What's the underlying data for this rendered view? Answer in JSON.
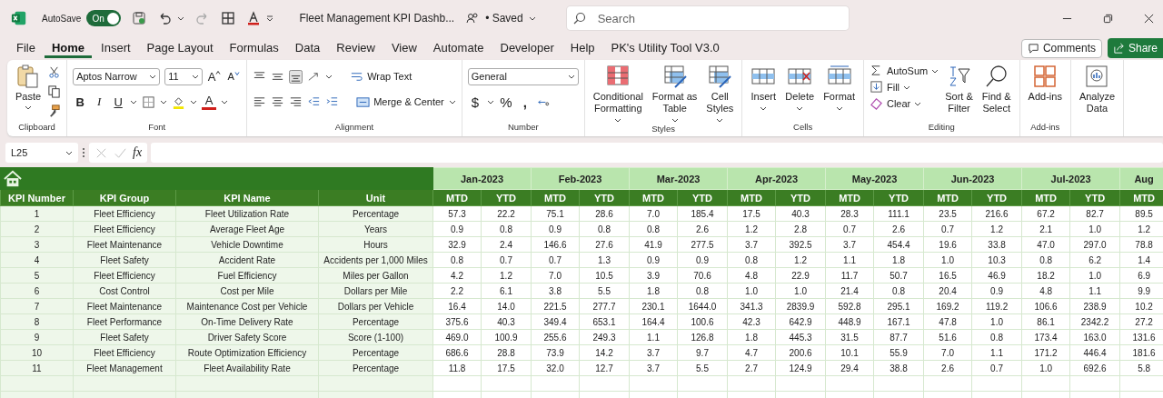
{
  "title_bar": {
    "autosave_label": "AutoSave",
    "autosave": {
      "on": true,
      "label": "On"
    },
    "document_title": "Fleet Management KPI Dashb...",
    "save_status": "• Saved",
    "search": {
      "placeholder": "Search"
    }
  },
  "tabs": [
    {
      "label": "File",
      "selected": false
    },
    {
      "label": "Home",
      "selected": true
    },
    {
      "label": "Insert",
      "selected": false
    },
    {
      "label": "Page Layout",
      "selected": false
    },
    {
      "label": "Formulas",
      "selected": false
    },
    {
      "label": "Data",
      "selected": false
    },
    {
      "label": "Review",
      "selected": false
    },
    {
      "label": "View",
      "selected": false
    },
    {
      "label": "Automate",
      "selected": false
    },
    {
      "label": "Developer",
      "selected": false
    },
    {
      "label": "Help",
      "selected": false
    },
    {
      "label": "PK's Utility Tool V3.0",
      "selected": false
    }
  ],
  "comments_button": "Comments",
  "share_button": "Share",
  "ribbon": [
    {
      "kind": "clipboard",
      "label": "Clipboard",
      "paste": "Paste"
    },
    {
      "kind": "font",
      "label": "Font",
      "font_name": "Aptos Narrow",
      "font_size": "11",
      "grow": "A",
      "shrink": "A",
      "bold": "B",
      "italic": "I",
      "underline": "U",
      "font_color": "A"
    },
    {
      "kind": "alignment",
      "label": "Alignment",
      "wrap": "Wrap Text",
      "merge": "Merge & Center"
    },
    {
      "kind": "number",
      "label": "Number",
      "format": "General",
      "currency": "$",
      "percent": "%",
      "comma": ","
    },
    {
      "kind": "styles",
      "label": "Styles",
      "buttons": [
        {
          "lines": [
            "Conditional",
            "Formatting"
          ]
        },
        {
          "lines": [
            "Format as",
            "Table"
          ]
        },
        {
          "lines": [
            "Cell",
            "Styles"
          ]
        }
      ]
    },
    {
      "kind": "cells",
      "label": "Cells",
      "buttons": [
        {
          "lines": [
            "Insert"
          ]
        },
        {
          "lines": [
            "Delete"
          ]
        },
        {
          "lines": [
            "Format"
          ]
        }
      ]
    },
    {
      "kind": "editing",
      "label": "Editing",
      "autosum": "AutoSum",
      "fill": "Fill",
      "clear": "Clear",
      "sort": [
        "Sort &",
        "Filter"
      ],
      "find": [
        "Find &",
        "Select"
      ]
    },
    {
      "kind": "addins",
      "label": "Add-ins",
      "buttons": [
        {
          "lines": [
            "Add-ins"
          ]
        }
      ]
    },
    {
      "kind": "analyze",
      "buttons": [
        {
          "lines": [
            "Analyze",
            "Data"
          ]
        }
      ]
    }
  ],
  "formula_bar": {
    "name_box": "L25",
    "fx": "fx"
  },
  "sheet": {
    "columns": [
      "KPI Number",
      "KPI Group",
      "KPI Name",
      "Unit"
    ],
    "months": [
      "Jan-2023",
      "Feb-2023",
      "Mar-2023",
      "Apr-2023",
      "May-2023",
      "Jun-2023",
      "Jul-2023",
      "Aug"
    ],
    "sub_columns": [
      "MTD",
      "YTD",
      "MTD",
      "YTD",
      "MTD",
      "YTD",
      "MTD",
      "YTD",
      "MTD",
      "YTD",
      "MTD",
      "YTD",
      "MTD",
      "YTD",
      "MTD"
    ],
    "rows": [
      {
        "number": "1",
        "group": "Fleet Efficiency",
        "name": "Fleet Utilization Rate",
        "unit": "Percentage",
        "values": [
          "57.3",
          "22.2",
          "75.1",
          "28.6",
          "7.0",
          "185.4",
          "17.5",
          "40.3",
          "28.3",
          "111.1",
          "23.5",
          "216.6",
          "67.2",
          "82.7",
          "89.5"
        ]
      },
      {
        "number": "2",
        "group": "Fleet Efficiency",
        "name": "Average Fleet Age",
        "unit": "Years",
        "values": [
          "0.9",
          "0.8",
          "0.9",
          "0.8",
          "0.8",
          "2.6",
          "1.2",
          "2.8",
          "0.7",
          "2.6",
          "0.7",
          "1.2",
          "2.1",
          "1.0",
          "1.2"
        ]
      },
      {
        "number": "3",
        "group": "Fleet Maintenance",
        "name": "Vehicle Downtime",
        "unit": "Hours",
        "values": [
          "32.9",
          "2.4",
          "146.6",
          "27.6",
          "41.9",
          "277.5",
          "3.7",
          "392.5",
          "3.7",
          "454.4",
          "19.6",
          "33.8",
          "47.0",
          "297.0",
          "78.8"
        ]
      },
      {
        "number": "4",
        "group": "Fleet Safety",
        "name": "Accident Rate",
        "unit": "Accidents per 1,000 Miles",
        "values": [
          "0.8",
          "0.7",
          "0.7",
          "1.3",
          "0.9",
          "0.9",
          "0.8",
          "1.2",
          "1.1",
          "1.8",
          "1.0",
          "10.3",
          "0.8",
          "6.2",
          "1.4"
        ]
      },
      {
        "number": "5",
        "group": "Fleet Efficiency",
        "name": "Fuel Efficiency",
        "unit": "Miles per Gallon",
        "values": [
          "4.2",
          "1.2",
          "7.0",
          "10.5",
          "3.9",
          "70.6",
          "4.8",
          "22.9",
          "11.7",
          "50.7",
          "16.5",
          "46.9",
          "18.2",
          "1.0",
          "6.9"
        ]
      },
      {
        "number": "6",
        "group": "Cost Control",
        "name": "Cost per Mile",
        "unit": "Dollars per Mile",
        "values": [
          "2.2",
          "6.1",
          "3.8",
          "5.5",
          "1.8",
          "0.8",
          "1.0",
          "1.0",
          "21.4",
          "0.8",
          "20.4",
          "0.9",
          "4.8",
          "1.1",
          "9.9"
        ]
      },
      {
        "number": "7",
        "group": "Fleet Maintenance",
        "name": "Maintenance Cost per Vehicle",
        "unit": "Dollars per Vehicle",
        "values": [
          "16.4",
          "14.0",
          "221.5",
          "277.7",
          "230.1",
          "1644.0",
          "341.3",
          "2839.9",
          "592.8",
          "295.1",
          "169.2",
          "119.2",
          "106.6",
          "238.9",
          "10.2"
        ]
      },
      {
        "number": "8",
        "group": "Fleet Performance",
        "name": "On-Time Delivery Rate",
        "unit": "Percentage",
        "values": [
          "375.6",
          "40.3",
          "349.4",
          "653.1",
          "164.4",
          "100.6",
          "42.3",
          "642.9",
          "448.9",
          "167.1",
          "47.8",
          "1.0",
          "86.1",
          "2342.2",
          "27.2"
        ]
      },
      {
        "number": "9",
        "group": "Fleet Safety",
        "name": "Driver Safety Score",
        "unit": "Score (1-100)",
        "values": [
          "469.0",
          "100.9",
          "255.6",
          "249.3",
          "1.1",
          "126.8",
          "1.8",
          "445.3",
          "31.5",
          "87.7",
          "51.6",
          "0.8",
          "173.4",
          "163.0",
          "131.6"
        ]
      },
      {
        "number": "10",
        "group": "Fleet Efficiency",
        "name": "Route Optimization Efficiency",
        "unit": "Percentage",
        "values": [
          "686.6",
          "28.8",
          "73.9",
          "14.2",
          "3.7",
          "9.7",
          "4.7",
          "200.6",
          "10.1",
          "55.9",
          "7.0",
          "1.1",
          "171.2",
          "446.4",
          "181.6"
        ]
      },
      {
        "number": "11",
        "group": "Fleet Management",
        "name": "Fleet Availability Rate",
        "unit": "Percentage",
        "values": [
          "11.8",
          "17.5",
          "32.0",
          "12.7",
          "3.7",
          "5.5",
          "2.7",
          "124.9",
          "29.4",
          "38.8",
          "2.6",
          "0.7",
          "1.0",
          "692.6",
          "5.8"
        ]
      }
    ]
  }
}
